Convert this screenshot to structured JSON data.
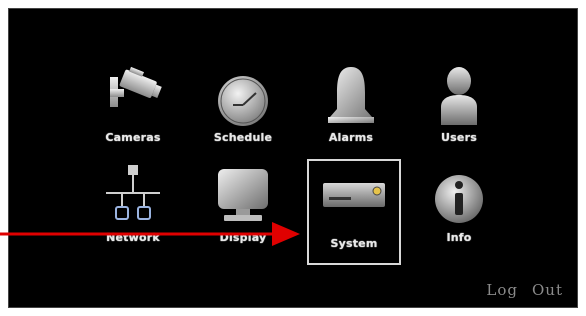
{
  "menu": {
    "items": [
      {
        "label": "Cameras",
        "icon": "camera-icon"
      },
      {
        "label": "Schedule",
        "icon": "clock-icon"
      },
      {
        "label": "Alarms",
        "icon": "bell-icon"
      },
      {
        "label": "Users",
        "icon": "user-icon"
      },
      {
        "label": "Network",
        "icon": "network-icon"
      },
      {
        "label": "Display",
        "icon": "monitor-icon"
      },
      {
        "label": "System",
        "icon": "dvr-icon",
        "selected": true
      },
      {
        "label": "Info",
        "icon": "info-icon"
      }
    ]
  },
  "footer": {
    "log_label": "Log",
    "out_label": "Out"
  },
  "colors": {
    "background": "#000000",
    "icon_gray": "#c8c8c8",
    "arrow": "#e00000"
  },
  "annotation": {
    "type": "arrow",
    "points_to": "System"
  }
}
